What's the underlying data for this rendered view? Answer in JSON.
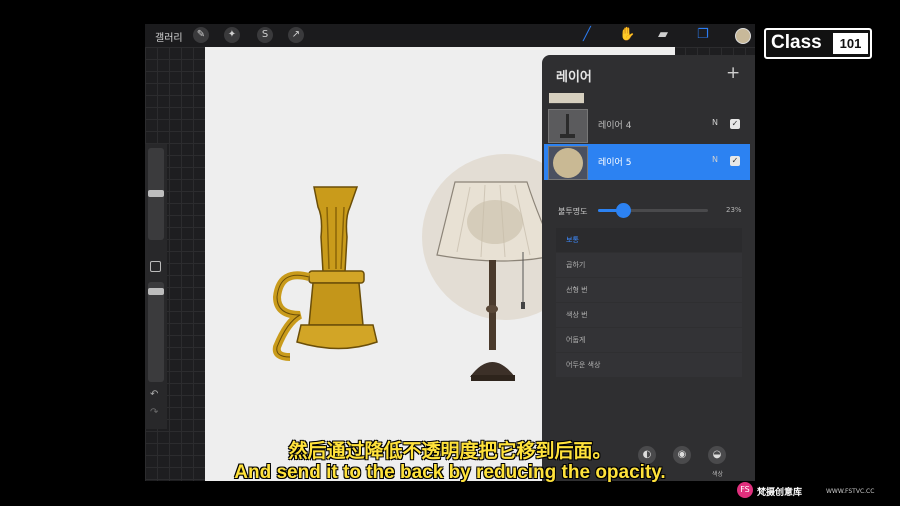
{
  "topbar": {
    "gallery_label": "갤러리",
    "tool_icons": [
      "wrench-icon",
      "magic-wand-icon",
      "selection-icon",
      "transform-arrow-icon"
    ],
    "right_icons": [
      "brush-icon",
      "smudge-icon",
      "eraser-icon",
      "layers-icon"
    ],
    "active_color": "#c8b99a"
  },
  "layers_panel": {
    "title": "레이어",
    "add_label": "+",
    "layers": [
      {
        "name": "레이어 4",
        "mode": "N",
        "visible": true
      },
      {
        "name": "레이어 5",
        "mode": "N",
        "visible": true,
        "active": true
      }
    ],
    "opacity": {
      "label": "불투명도",
      "value": "23%",
      "fraction": 0.23
    },
    "blend_modes": [
      "보통",
      "곱하기",
      "선형 번",
      "색상 번",
      "어둡게",
      "어두운 색상"
    ],
    "selected_blend": "보통",
    "bottom_label": "색상"
  },
  "side_toolbar": {
    "undo_glyph": "↶",
    "redo_glyph": "↷"
  },
  "brand": {
    "name": "Class",
    "number": "101"
  },
  "subtitles": {
    "chinese": "然后通过降低不透明度把它移到后面。",
    "english": "And send it to the back by reducing the opacity."
  },
  "watermark": {
    "icon": "FS",
    "name": "梵摄创意库",
    "url": "WWW.FSTVC.CC"
  },
  "colors": {
    "accent": "#2c82f2",
    "subtitle": "#ffe23b",
    "lamp_shade": "#e8e1d4",
    "candle_gold": "#c99b1b"
  }
}
